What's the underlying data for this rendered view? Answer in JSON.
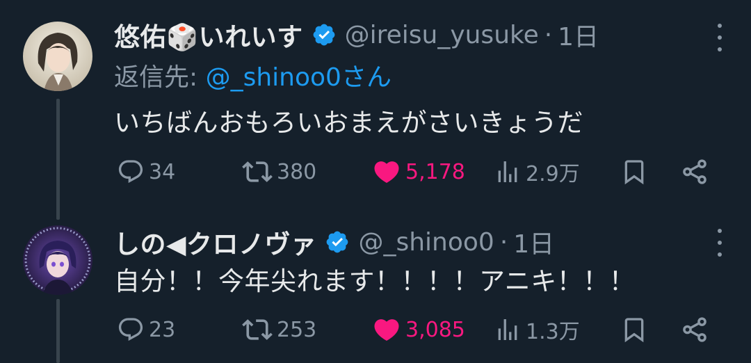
{
  "tweets": [
    {
      "display_name": "悠佑🎲いれいす",
      "handle": "@ireisu_yusuke",
      "separator": "·",
      "time": "1日",
      "reply_prefix": "返信先:",
      "reply_mention": "@_shinoo0さん",
      "text": "いちばんおもろいおまえがさいきょうだ",
      "replies": "34",
      "retweets": "380",
      "likes": "5,178",
      "views": "2.9万"
    },
    {
      "display_name": "しの◀クロノヴァ",
      "handle": "@_shinoo0",
      "separator": "·",
      "time": "1日",
      "text": "自分！！今年尖れます！！！！アニキ！！！",
      "replies": "23",
      "retweets": "253",
      "likes": "3,085",
      "views": "1.3万"
    }
  ],
  "colors": {
    "background": "#15202b",
    "text": "#e7e9ea",
    "muted": "#8b98a5",
    "accent": "#1d9bf0",
    "like": "#f91880",
    "thread_line": "#38444d"
  },
  "icons": [
    "verified-badge-icon",
    "more-icon",
    "reply-icon",
    "retweet-icon",
    "like-icon",
    "views-icon",
    "bookmark-icon",
    "share-icon"
  ]
}
